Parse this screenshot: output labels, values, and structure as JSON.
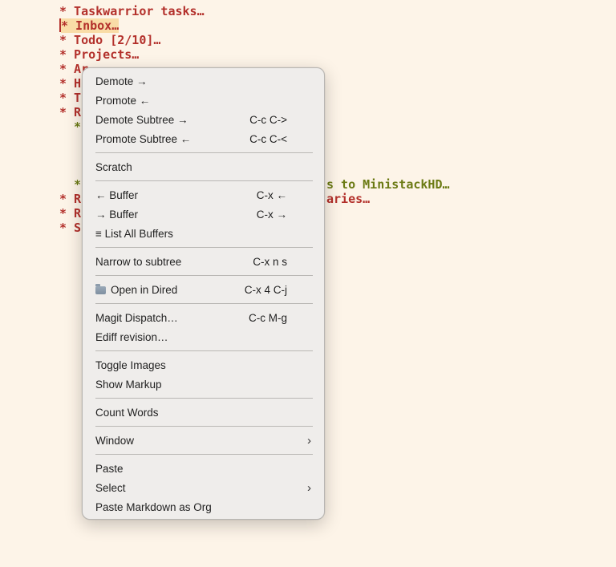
{
  "editor": {
    "lines": [
      "* Taskwarrior tasks…",
      "* Inbox…",
      "* Todo [2/10]…",
      "* Projects…",
      "* Ar",
      "* H",
      "* T",
      "* R",
      "*",
      "*",
      "* R",
      "* R",
      "* S"
    ],
    "fragments": {
      "ministack": "s to MinistackHD…",
      "libraries": "aries…"
    }
  },
  "menu": {
    "items": [
      {
        "label": "Demote →",
        "shortcut": ""
      },
      {
        "label": "Promote ←",
        "shortcut": ""
      },
      {
        "label": "Demote Subtree →",
        "shortcut": "C-c C->"
      },
      {
        "label": "Promote Subtree ←",
        "shortcut": "C-c C-<"
      },
      {
        "label": "Scratch",
        "shortcut": ""
      },
      {
        "label": "← Buffer",
        "shortcut": "C-x ←"
      },
      {
        "label": "→ Buffer",
        "shortcut": "C-x →"
      },
      {
        "label": "≡ List All Buffers",
        "shortcut": ""
      },
      {
        "label": "Narrow to subtree",
        "shortcut": "C-x n s"
      },
      {
        "label": "Open in Dired",
        "shortcut": "C-x 4 C-j"
      },
      {
        "label": "Magit Dispatch…",
        "shortcut": "C-c M-g"
      },
      {
        "label": "Ediff revision…",
        "shortcut": ""
      },
      {
        "label": "Toggle Images",
        "shortcut": ""
      },
      {
        "label": "Show Markup",
        "shortcut": ""
      },
      {
        "label": "Count Words",
        "shortcut": ""
      },
      {
        "label": "Window",
        "shortcut": ""
      },
      {
        "label": "Paste",
        "shortcut": ""
      },
      {
        "label": "Select",
        "shortcut": ""
      },
      {
        "label": "Paste Markdown as Org",
        "shortcut": ""
      }
    ],
    "submenu_arrow": "›",
    "icons": {
      "open_in_dired": "folder-icon"
    }
  },
  "colors": {
    "background": "#fdf4e8",
    "heading_red": "#b3302b",
    "heading_green": "#6b7a13",
    "highlight": "#f9dca7",
    "menu_bg": "#efedeb"
  }
}
